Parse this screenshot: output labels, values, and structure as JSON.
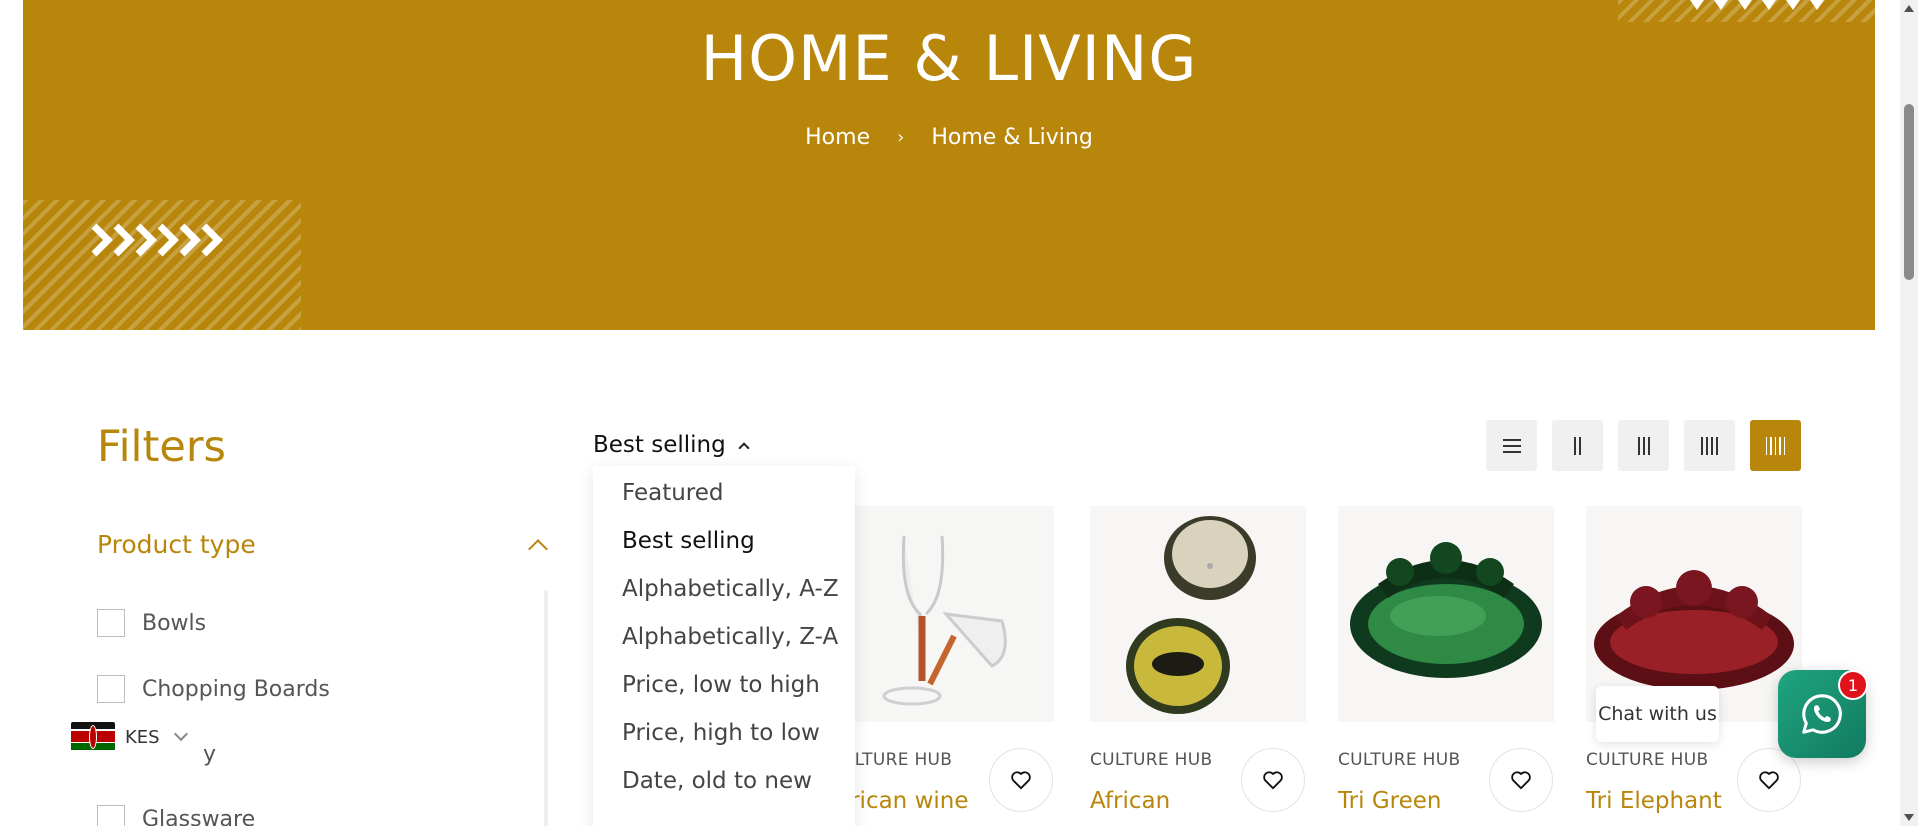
{
  "banner": {
    "title": "HOME & LIVING",
    "breadcrumb": [
      "Home",
      "Home & Living"
    ],
    "color": "#b8860b"
  },
  "filters": {
    "title": "Filters",
    "product_type_label": "Product type",
    "items": [
      "Bowls",
      "Chopping Boards",
      "y",
      "Glassware"
    ]
  },
  "currency": {
    "code": "KES"
  },
  "sort": {
    "current": "Best selling",
    "options": [
      "Featured",
      "Best selling",
      "Alphabetically, A-Z",
      "Alphabetically, Z-A",
      "Price, low to high",
      "Price, high to low",
      "Date, old to new"
    ]
  },
  "view_modes": [
    "list-view-icon",
    "two-column-icon",
    "three-column-icon",
    "four-column-icon",
    "five-column-icon"
  ],
  "products": [
    {
      "vendor": "ULTURE HUB",
      "title": "frican wine"
    },
    {
      "vendor": "CULTURE HUB",
      "title": "African"
    },
    {
      "vendor": "CULTURE HUB",
      "title": "Tri Green"
    },
    {
      "vendor": "CULTURE HUB",
      "title": "Tri Elephant"
    }
  ],
  "chat": {
    "label": "Chat with us",
    "badge": "1",
    "color": "#1fa57f"
  }
}
